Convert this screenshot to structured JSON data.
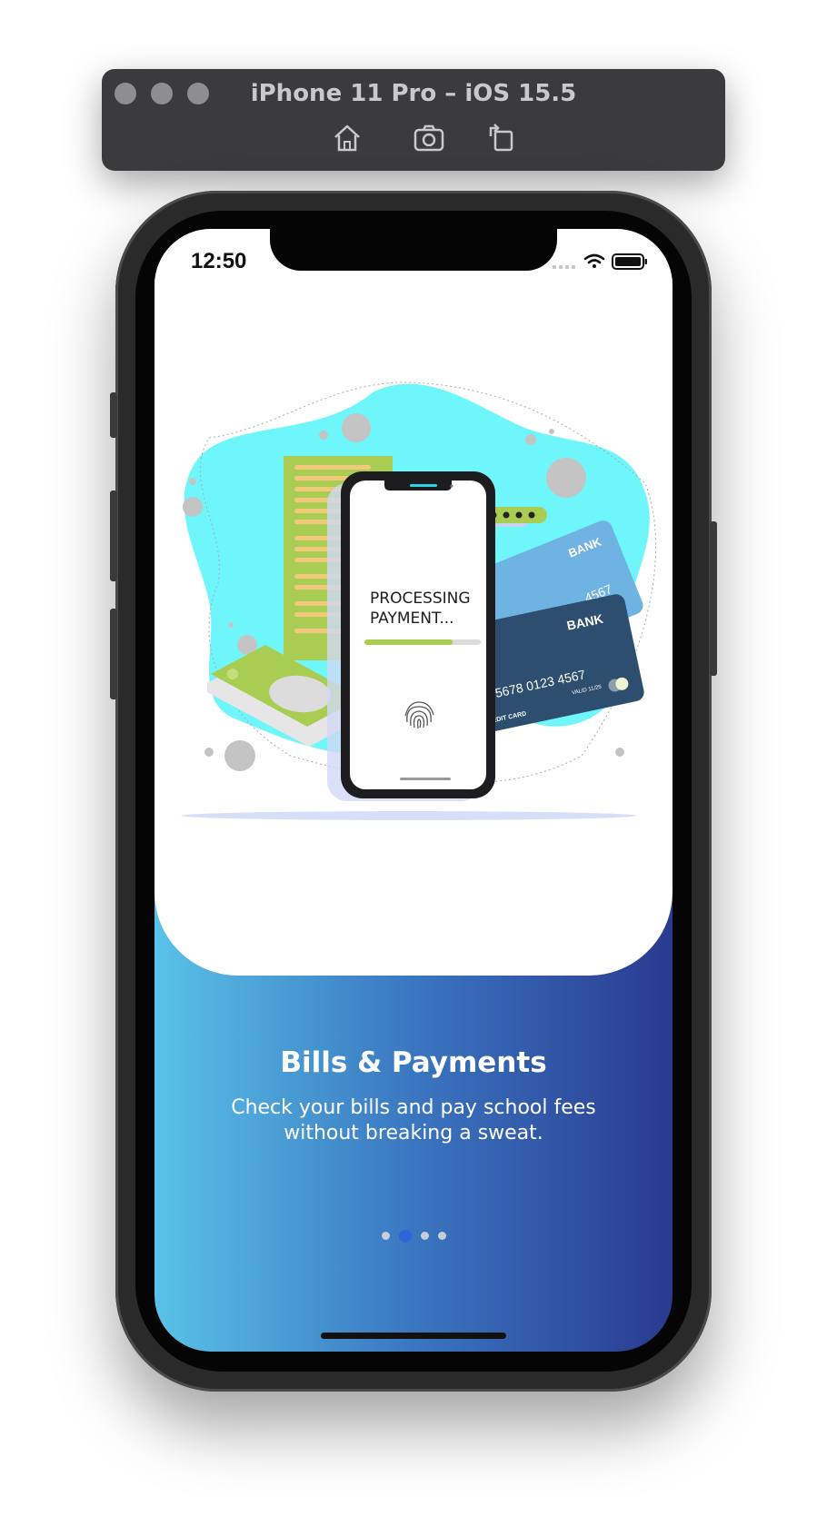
{
  "simulator": {
    "title": "iPhone 11 Pro – iOS 15.5",
    "tools": [
      "home-icon",
      "screenshot-icon",
      "rotate-icon"
    ]
  },
  "status_bar": {
    "time": "12:50"
  },
  "illustration": {
    "phone_text_line1": "PROCESSING",
    "phone_text_line2": "PAYMENT...",
    "progress": 0.76,
    "card_front_bank": "BANK",
    "card_front_number": "34 5678 0123 4567",
    "card_front_expiry": "VALID 11/25",
    "card_front_label": "CREDIT CARD",
    "card_back_bank": "BANK",
    "card_back_number": "4567"
  },
  "onboarding": {
    "title": "Bills & Payments",
    "subtitle": "Check your bills and pay school fees without breaking a sweat.",
    "page_count": 4,
    "active_page": 2
  },
  "colors": {
    "gradient_start": "#59c2e8",
    "gradient_end": "#2a3a90",
    "blob": "#6ff6fb",
    "accent_green": "#a9cc52",
    "active_dot": "#2f63d9"
  }
}
